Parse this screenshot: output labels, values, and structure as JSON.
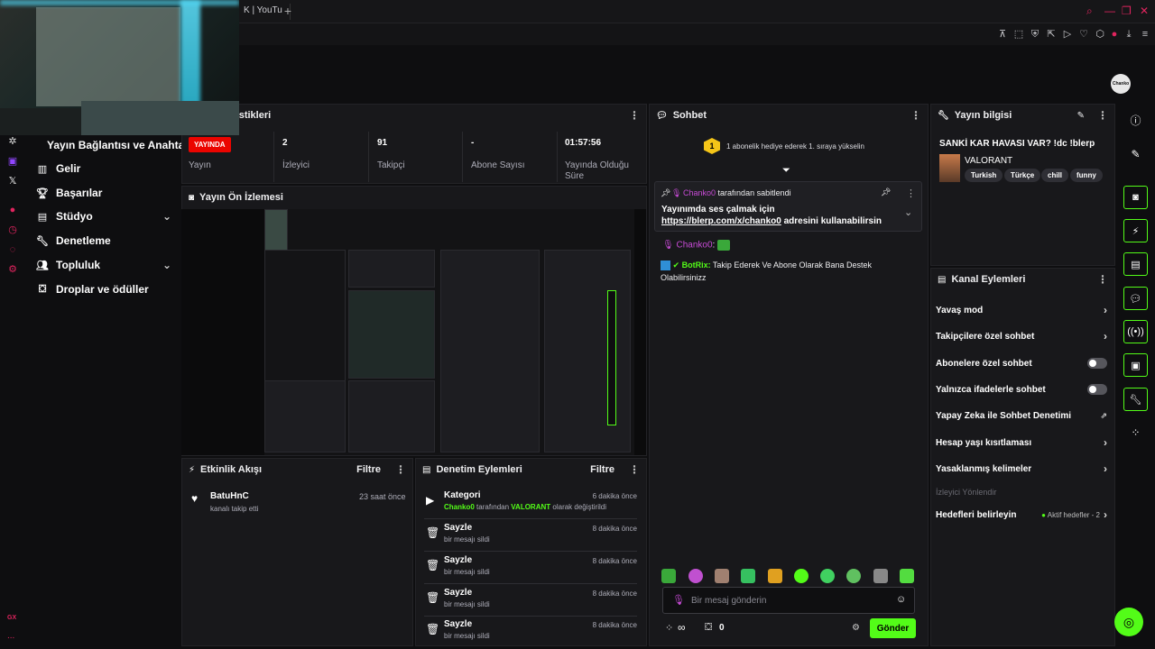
{
  "browser": {
    "tab_fragment": "K | YouTu",
    "new_tab": "+",
    "toolbar_icons": [
      "pin-icon",
      "screenshot-icon",
      "shield-icon",
      "share-icon",
      "play-icon",
      "heart-icon",
      "extensions-icon",
      "user-icon",
      "download-icon",
      "menu-icon"
    ]
  },
  "left_rail": {
    "icons": [
      "openai-icon",
      "twitch-icon",
      "x-icon",
      "music-icon",
      "clock-icon",
      "chat-icon",
      "settings-icon"
    ],
    "bottom_label": "GX",
    "more": "..."
  },
  "nav": {
    "title": "Yayın Bağlantısı ve Anahtarı",
    "items": [
      {
        "label": "Gelir",
        "icon": "chart-icon"
      },
      {
        "label": "Başarılar",
        "icon": "trophy-icon"
      },
      {
        "label": "Stüdyo",
        "icon": "studio-icon",
        "expandable": true
      },
      {
        "label": "Denetleme",
        "icon": "wrench-icon"
      },
      {
        "label": "Topluluk",
        "icon": "community-icon",
        "expandable": true
      },
      {
        "label": "Droplar ve ödüller",
        "icon": "gift-icon"
      }
    ]
  },
  "stats": {
    "header_fragment": "tistikleri",
    "live_badge": "YAYINDA",
    "cells": [
      {
        "value": "",
        "label": "Yayın"
      },
      {
        "value": "2",
        "label": "İzleyici"
      },
      {
        "value": "91",
        "label": "Takipçi"
      },
      {
        "value": "-",
        "label": "Abone Sayısı"
      },
      {
        "value": "01:57:56",
        "label": "Yayında Olduğu Süre"
      }
    ]
  },
  "preview": {
    "title": "Yayın Ön İzlemesi"
  },
  "events": {
    "title": "Etkinlik Akışı",
    "filter": "Filtre",
    "items": [
      {
        "name": "BatuHnC",
        "sub": "kanalı takip etti",
        "time": "23 saat önce"
      }
    ]
  },
  "moderation": {
    "title": "Denetim Eylemleri",
    "filter": "Filtre",
    "category": {
      "title": "Kategori",
      "user": "Chanko0",
      "text1": "tarafından",
      "game": "VALORANT",
      "text2": "olarak değiştirildi",
      "time": "6 dakika önce"
    },
    "items": [
      {
        "title": "Sayzle",
        "sub": "bir mesajı sildi",
        "time": "8 dakika önce"
      },
      {
        "title": "Sayzle",
        "sub": "bir mesajı sildi",
        "time": "8 dakika önce"
      },
      {
        "title": "Sayzle",
        "sub": "bir mesajı sildi",
        "time": "8 dakika önce"
      },
      {
        "title": "Sayzle",
        "sub": "bir mesajı sildi",
        "time": "8 dakika önce"
      }
    ]
  },
  "chat": {
    "title": "Sohbet",
    "gift_rank": "1",
    "gift_text": "1 abonelik hediye ederek 1. sıraya yükselin",
    "pinned": {
      "user": "Chanko0",
      "suffix": "tarafından sabitlendi",
      "text1": "Yayınımda ses çalmak için",
      "link": "https://blerp.com/x/chanko0",
      "text2": "adresini kullanabilirsin"
    },
    "messages": [
      {
        "user": "Chanko0",
        "text": ":"
      },
      {
        "user": "BotRix:",
        "text": "Takip Ederek Ve Abone Olarak Bana Destek Olabilirsinizz"
      }
    ],
    "input_placeholder": "Bir mesaj gönderin",
    "points": "∞",
    "gift_count": "0",
    "send": "Gönder",
    "emote_colors": [
      "#3aa83a",
      "#c050d0",
      "#a08070",
      "#36c060",
      "#e0a020",
      "#53fc18",
      "#40d060",
      "#60c060",
      "#888888",
      "#53dc40"
    ]
  },
  "stream_info": {
    "title": "Yayın bilgisi",
    "stream_title": "SANKİ KAR HAVASI VAR? !dc !blerp",
    "category": "VALORANT",
    "tags": [
      "Turkish",
      "Türkçe",
      "chill",
      "funny"
    ]
  },
  "channel_actions": {
    "title": "Kanal Eylemleri",
    "rows": [
      {
        "label": "Yavaş mod",
        "control": "chevron"
      },
      {
        "label": "Takipçilere özel sohbet",
        "control": "chevron"
      },
      {
        "label": "Abonelere özel sohbet",
        "control": "toggle"
      },
      {
        "label": "Yalnızca ifadelerle sohbet",
        "control": "toggle"
      },
      {
        "label": "Yapay Zeka ile Sohbet Denetimi",
        "control": "external"
      },
      {
        "label": "Hesap yaşı kısıtlaması",
        "control": "chevron"
      },
      {
        "label": "Yasaklanmış kelimeler",
        "control": "chevron"
      }
    ],
    "redirect": "İzleyici Yönlendir",
    "goals_label": "Hedefleri belirleyin",
    "goals_status": "Aktif hedefler - 2"
  },
  "avatar_text": "Chanko",
  "colors": {
    "accent": "#53fc18",
    "live": "#eb0400",
    "panel": "#18181b",
    "background": "#0e0e10",
    "pink": "#c74bd6"
  }
}
